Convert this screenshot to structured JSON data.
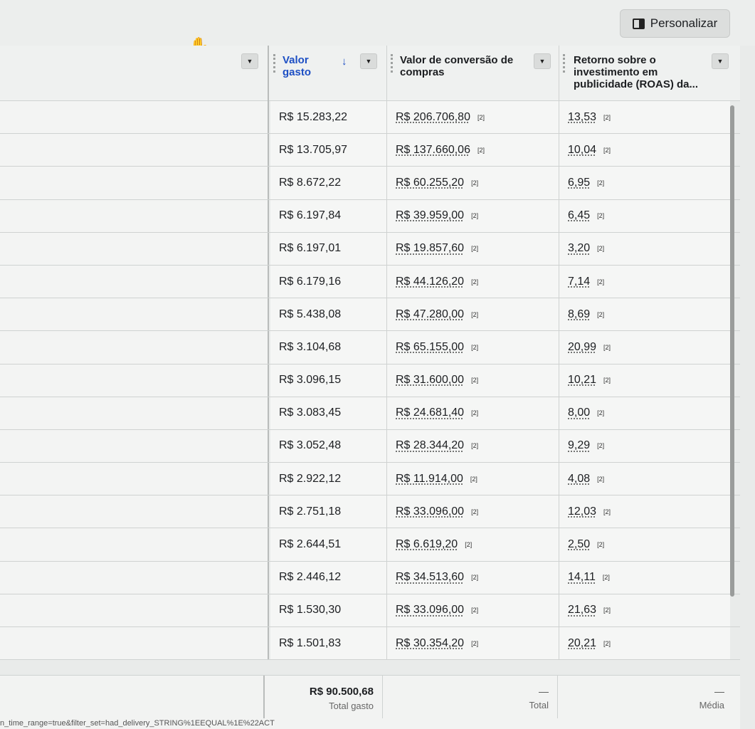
{
  "toolbar": {
    "personalize_label": "Personalizar"
  },
  "headers": {
    "spend": "Valor gasto",
    "conversion": "Valor de conversão de compras",
    "roas": "Retorno sobre o investimento em publicidade (ROAS) da..."
  },
  "rows": [
    {
      "spend": "R$ 15.283,22",
      "conversion": "R$ 206.706,80",
      "conv_note": "[2]",
      "roas": "13,53",
      "roas_note": "[2]"
    },
    {
      "spend": "R$ 13.705,97",
      "conversion": "R$ 137.660,06",
      "conv_note": "[2]",
      "roas": "10,04",
      "roas_note": "[2]"
    },
    {
      "spend": "R$ 8.672,22",
      "conversion": "R$ 60.255,20",
      "conv_note": "[2]",
      "roas": "6,95",
      "roas_note": "[2]"
    },
    {
      "spend": "R$ 6.197,84",
      "conversion": "R$ 39.959,00",
      "conv_note": "[2]",
      "roas": "6,45",
      "roas_note": "[2]"
    },
    {
      "spend": "R$ 6.197,01",
      "conversion": "R$ 19.857,60",
      "conv_note": "[2]",
      "roas": "3,20",
      "roas_note": "[2]"
    },
    {
      "spend": "R$ 6.179,16",
      "conversion": "R$ 44.126,20",
      "conv_note": "[2]",
      "roas": "7,14",
      "roas_note": "[2]"
    },
    {
      "spend": "R$ 5.438,08",
      "conversion": "R$ 47.280,00",
      "conv_note": "[2]",
      "roas": "8,69",
      "roas_note": "[2]"
    },
    {
      "spend": "R$ 3.104,68",
      "conversion": "R$ 65.155,00",
      "conv_note": "[2]",
      "roas": "20,99",
      "roas_note": "[2]"
    },
    {
      "spend": "R$ 3.096,15",
      "conversion": "R$ 31.600,00",
      "conv_note": "[2]",
      "roas": "10,21",
      "roas_note": "[2]"
    },
    {
      "spend": "R$ 3.083,45",
      "conversion": "R$ 24.681,40",
      "conv_note": "[2]",
      "roas": "8,00",
      "roas_note": "[2]"
    },
    {
      "spend": "R$ 3.052,48",
      "conversion": "R$ 28.344,20",
      "conv_note": "[2]",
      "roas": "9,29",
      "roas_note": "[2]"
    },
    {
      "spend": "R$ 2.922,12",
      "conversion": "R$ 11.914,00",
      "conv_note": "[2]",
      "roas": "4,08",
      "roas_note": "[2]"
    },
    {
      "spend": "R$ 2.751,18",
      "conversion": "R$ 33.096,00",
      "conv_note": "[2]",
      "roas": "12,03",
      "roas_note": "[2]"
    },
    {
      "spend": "R$ 2.644,51",
      "conversion": "R$ 6.619,20",
      "conv_note": "[2]",
      "roas": "2,50",
      "roas_note": "[2]"
    },
    {
      "spend": "R$ 2.446,12",
      "conversion": "R$ 34.513,60",
      "conv_note": "[2]",
      "roas": "14,11",
      "roas_note": "[2]"
    },
    {
      "spend": "R$ 1.530,30",
      "conversion": "R$ 33.096,00",
      "conv_note": "[2]",
      "roas": "21,63",
      "roas_note": "[2]"
    },
    {
      "spend": "R$ 1.501,83",
      "conversion": "R$ 30.354,20",
      "conv_note": "[2]",
      "roas": "20,21",
      "roas_note": "[2]"
    }
  ],
  "footer": {
    "spend_total": "R$ 90.500,68",
    "spend_label": "Total gasto",
    "conv_value": "—",
    "conv_label": "Total",
    "roas_value": "—",
    "roas_label": "Média"
  },
  "url_fragment": "n_time_range=true&filter_set=had_delivery_STRING%1EEQUAL%1E%22ACT"
}
